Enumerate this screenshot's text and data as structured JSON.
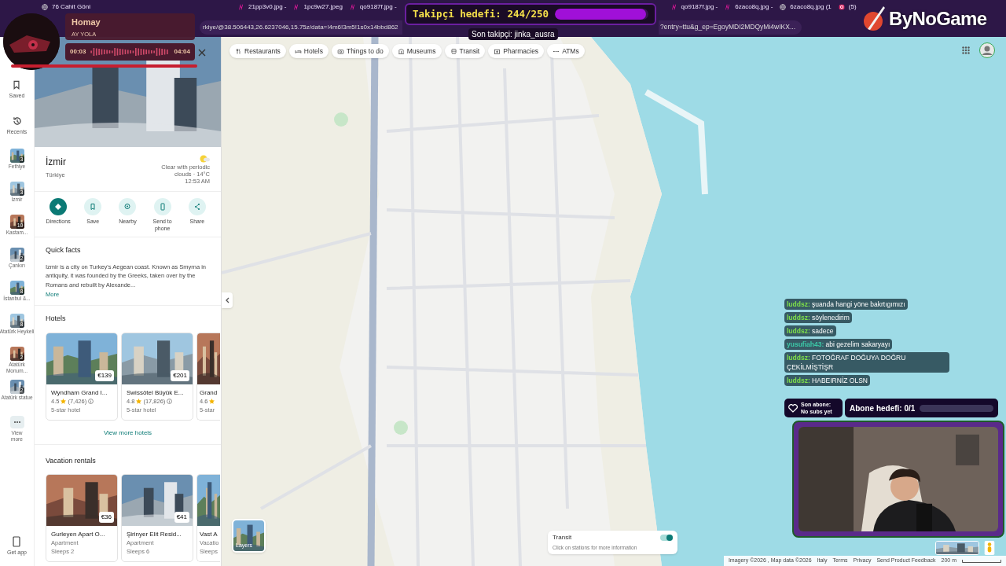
{
  "browser": {
    "tabs": [
      {
        "title": "76 Cahit Göni",
        "kind": "site"
      },
      {
        "title": "21pp3v0.jpg - "
      },
      {
        "title": "1pc9w27.jpeg"
      },
      {
        "title": "qo9187f.jpg - "
      },
      {
        "title": "qo9187f.jpg - "
      },
      {
        "title": "6zaco8q.jpg - "
      },
      {
        "title": "6zaco8q.jpg (1",
        "kind": "site"
      },
      {
        "title": "(5)",
        "kind": "insta"
      }
    ],
    "url_start": "rkiye/@38.506443,26.6237046,15.75z/data=!4m6!3m5!1s0x14bbd862",
    "url_end": "?entry=ttu&g_ep=EgoyMDI2MDQyMi4wIKX..."
  },
  "stream": {
    "music": {
      "title": "Homay",
      "artist": "AY YOLA",
      "elapsed": "00:03",
      "total": "04:04"
    },
    "follower_goal": {
      "label": "Takipçi hedefi: 244/250",
      "level": 0.976,
      "last": "Son takipçi: jinka_ausra"
    },
    "logo": "ByNoGame",
    "chat": [
      {
        "user": "luddsz:",
        "color": "#7ee04a",
        "text": "şuanda hangi yöne bakrtıgımızı"
      },
      {
        "user": "luddsz:",
        "color": "#7ee04a",
        "text": "söylenedirim"
      },
      {
        "user": "luddsz:",
        "color": "#7ee04a",
        "text": "sadece"
      },
      {
        "user": "yusufiah43:",
        "color": "#3cc9a8",
        "text": "abi gezelim sakaryayı"
      },
      {
        "user": "luddsz:",
        "color": "#7ee04a",
        "text": "FOTOĞRAF DOĞUYA DOĞRU ÇEKİLMİŞTİŞR"
      },
      {
        "user": "luddsz:",
        "color": "#7ee04a",
        "text": "HABEIRNİZ OLSN"
      }
    ],
    "last_sub": {
      "label": "Son abone:",
      "value": "No subs yet"
    },
    "sub_goal": {
      "label": "Abone hedefi: 0/1",
      "level": 0
    }
  },
  "rail": {
    "top": [
      {
        "label": "Saved",
        "kind": "bookmark"
      },
      {
        "label": "Recents",
        "kind": "history"
      }
    ],
    "recent": [
      {
        "label": "Fethiye",
        "count": "3"
      },
      {
        "label": "İzmir",
        "count": "3"
      },
      {
        "label": "Kastam...",
        "count": "10"
      },
      {
        "label": "Çankırı",
        "count": "2"
      },
      {
        "label": "İstanbul &...",
        "count": "8"
      },
      {
        "label": "Atatürk Heykeli",
        "count": "8"
      },
      {
        "label": "Atatürk Monum...",
        "count": "2"
      },
      {
        "label": "Atatürk statue",
        "count": "2"
      }
    ],
    "more": "View more",
    "get_app": "Get app"
  },
  "place": {
    "name": "İzmir",
    "country": "Türkiye",
    "weather": "Clear with periodic clouds · 14°C",
    "time": "12:53 AM",
    "actions": [
      {
        "label": "Directions",
        "kind": "directions",
        "primary": true
      },
      {
        "label": "Save",
        "kind": "save",
        "primary": false
      },
      {
        "label": "Nearby",
        "kind": "nearby",
        "primary": false
      },
      {
        "label": "Send to phone",
        "kind": "phone",
        "primary": false
      },
      {
        "label": "Share",
        "kind": "share",
        "primary": false
      }
    ],
    "facts_title": "Quick facts",
    "facts": "Izmir is a city on Turkey's Aegean coast. Known as Smyrna in antiquity, it was founded by the Greeks, taken over by the Romans and rebuilt by Alexande...",
    "more": "More",
    "hotels_title": "Hotels",
    "hotels": [
      {
        "name": "Wyndham Grand I...",
        "rating": "4.5",
        "reviews": "(7,426)",
        "type": "5-star hotel",
        "price": "€139"
      },
      {
        "name": "Swissôtel Büyük E...",
        "rating": "4.8",
        "reviews": "(17,826)",
        "type": "5-star hotel",
        "price": "€201"
      },
      {
        "name": "Grand",
        "rating": "4.6",
        "type": "5-star"
      }
    ],
    "hotels_more": "View more hotels",
    "rentals_title": "Vacation rentals",
    "rentals": [
      {
        "name": "Gurleyen Apart O...",
        "type": "Apartment",
        "sleeps": "Sleeps 2",
        "price": "€36"
      },
      {
        "name": "Şirinyer Elit Resid...",
        "type": "Apartment",
        "sleeps": "Sleeps 6",
        "price": "€41"
      },
      {
        "name": "Vast A",
        "type": "Vacatio",
        "sleeps": "Sleeps"
      }
    ]
  },
  "map": {
    "chips": [
      {
        "label": "Restaurants",
        "kind": "food"
      },
      {
        "label": "Hotels",
        "kind": "bed"
      },
      {
        "label": "Things to do",
        "kind": "camera"
      },
      {
        "label": "Museums",
        "kind": "museum"
      },
      {
        "label": "Transit",
        "kind": "bus"
      },
      {
        "label": "Pharmacies",
        "kind": "cross"
      },
      {
        "label": "ATMs",
        "kind": "atm"
      }
    ],
    "layers": "Layers",
    "transit": {
      "title": "Transit",
      "hint": "Click on stations for more information",
      "on": true
    },
    "footer": [
      "Imagery ©2026 , Map data ©2026",
      "Italy",
      "Terms",
      "Privacy",
      "Send Product Feedback"
    ],
    "scale": "200 m"
  }
}
